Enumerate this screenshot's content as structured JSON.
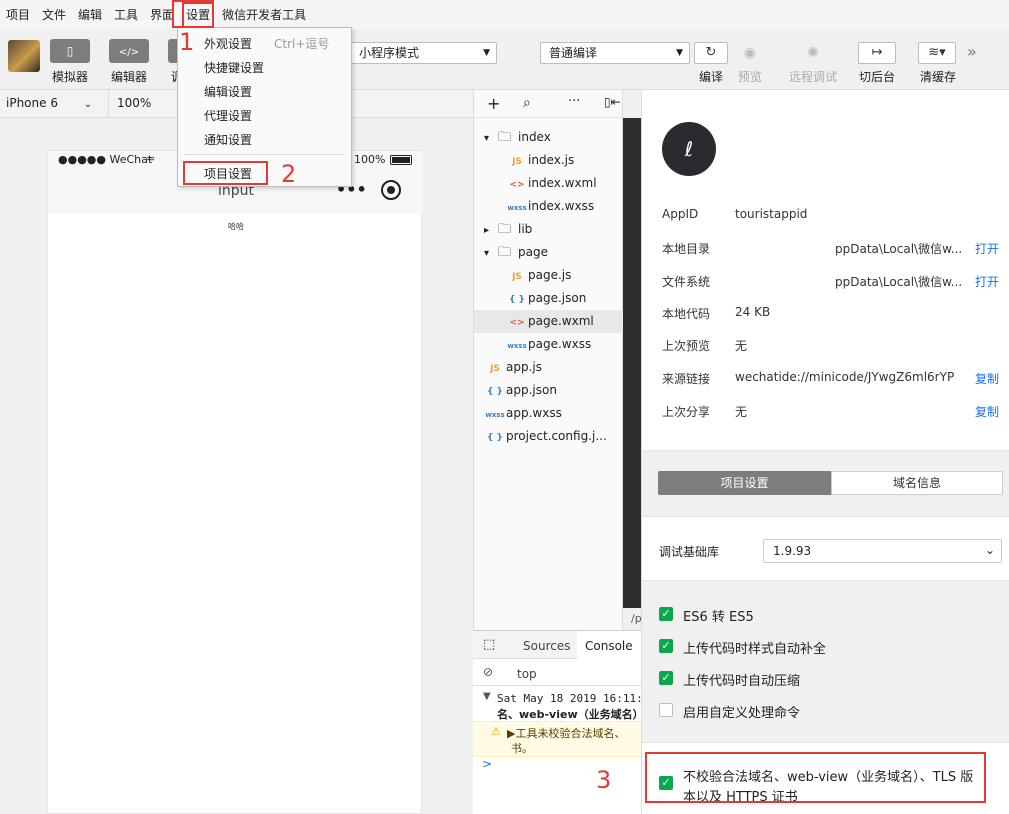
{
  "menubar": [
    "项目",
    "文件",
    "编辑",
    "工具",
    "界面",
    "设置",
    "微信开发者工具"
  ],
  "toolbar": {
    "simulator": "模拟器",
    "editor": "编辑器",
    "debugger_partial": "调",
    "mode_select": "小程序模式",
    "compile_select": "普通编译",
    "compile": "编译",
    "preview": "预览",
    "remote_debug": "远程调试",
    "background": "切后台",
    "clear_cache": "清缓存"
  },
  "dropdown": {
    "items": [
      "外观设置",
      "快捷键设置",
      "编辑设置",
      "代理设置",
      "通知设置"
    ],
    "shortcut": "Ctrl+逗号",
    "project_settings": "项目设置"
  },
  "simulator": {
    "device": "iPhone 6",
    "zoom": "100%",
    "carrier": "●●●●● WeChat",
    "battery": "100%",
    "page_title": "input",
    "content": "哈哈"
  },
  "filetree": [
    {
      "label": "index",
      "type": "folder",
      "open": true
    },
    {
      "label": "index.js",
      "type": "js"
    },
    {
      "label": "index.wxml",
      "type": "wxml"
    },
    {
      "label": "index.wxss",
      "type": "wxss"
    },
    {
      "label": "lib",
      "type": "folder",
      "open": false
    },
    {
      "label": "page",
      "type": "folder",
      "open": true
    },
    {
      "label": "page.js",
      "type": "js"
    },
    {
      "label": "page.json",
      "type": "json"
    },
    {
      "label": "page.wxml",
      "type": "wxml"
    },
    {
      "label": "page.wxss",
      "type": "wxss"
    },
    {
      "label": "app.js",
      "type": "js"
    },
    {
      "label": "app.json",
      "type": "json"
    },
    {
      "label": "app.wxss",
      "type": "wxss"
    },
    {
      "label": "project.config.j...",
      "type": "json"
    }
  ],
  "icons": {
    "js": "JS",
    "wxml": "<>",
    "wxss": "wxss",
    "json": "{ }"
  },
  "editor_tail": "/p",
  "console": {
    "tabs": [
      "Sources",
      "Console"
    ],
    "context": "top",
    "log_line1": "Sat May 18 2019 16:11:",
    "log_line2": "名、web-view（业务域名）",
    "warn_line1": "▶工具未校验合法域名、",
    "warn_line2": "书。",
    "prompt": ">"
  },
  "details": {
    "appid_label": "AppID",
    "appid": "touristappid",
    "local_dir_label": "本地目录",
    "local_dir": "ppData\\Local\\微信w...",
    "open": "打开",
    "filesystem_label": "文件系统",
    "filesystem": "ppData\\Local\\微信w...",
    "local_code_label": "本地代码",
    "local_code": "24 KB",
    "last_preview_label": "上次预览",
    "last_preview": "无",
    "source_link_label": "来源链接",
    "source_link": "wechatide://minicode/JYwgZ6ml6rYP",
    "copy": "复制",
    "last_share_label": "上次分享",
    "last_share": "无",
    "tabs": [
      "项目设置",
      "域名信息"
    ],
    "base_lib_label": "调试基础库",
    "base_lib": "1.9.93",
    "options": [
      {
        "label": "ES6 转 ES5",
        "checked": true
      },
      {
        "label": "上传代码时样式自动补全",
        "checked": true
      },
      {
        "label": "上传代码时自动压缩",
        "checked": true
      },
      {
        "label": "启用自定义处理命令",
        "checked": false
      }
    ],
    "tls_line1": "不校验合法域名、web-view（业务域名）、TLS 版",
    "tls_line2": "本以及 HTTPS 证书"
  },
  "annotations": [
    "1",
    "2",
    "3"
  ],
  "colors": {
    "accent_red": "#e53935",
    "check_green": "#0aa84e",
    "link_blue": "#1a73e8"
  }
}
